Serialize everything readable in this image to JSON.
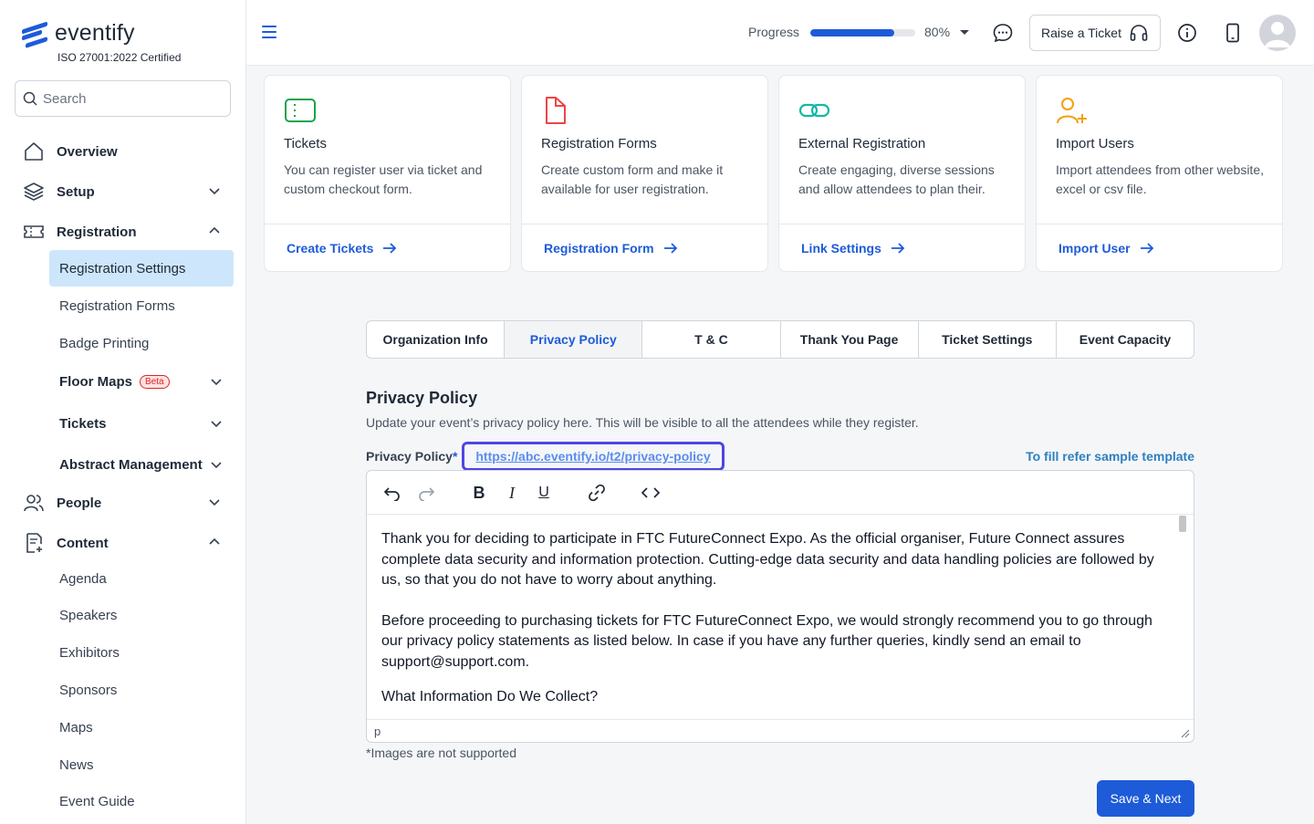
{
  "brand": {
    "name": "eventify",
    "certification": "ISO 27001:2022 Certified",
    "accent": "#1d5bd8"
  },
  "search": {
    "placeholder": "Search"
  },
  "sidebar": {
    "overview": "Overview",
    "setup": "Setup",
    "registration": "Registration",
    "registration_items": [
      "Registration Settings",
      "Registration Forms",
      "Badge Printing"
    ],
    "floor_maps": "Floor Maps",
    "beta": "Beta",
    "tickets": "Tickets",
    "abstract": "Abstract Management",
    "people": "People",
    "content": "Content",
    "content_items": [
      "Agenda",
      "Speakers",
      "Exhibitors",
      "Sponsors",
      "Maps",
      "News",
      "Event Guide"
    ]
  },
  "topbar": {
    "progress_label": "Progress",
    "progress_value": 0.8,
    "progress_pct": "80%",
    "raise_ticket": "Raise a Ticket"
  },
  "cards": [
    {
      "title": "Tickets",
      "desc": "You can register user via ticket and custom checkout form.",
      "link": "Create Tickets",
      "icon": "ticket-icon",
      "color": "#16a34a"
    },
    {
      "title": "Registration Forms",
      "desc": "Create custom form and make it available for user registration.",
      "link": "Registration Form",
      "icon": "document-icon",
      "color": "#ef4444"
    },
    {
      "title": "External Registration",
      "desc": "Create engaging, diverse sessions and allow attendees to plan their.",
      "link": "Link Settings",
      "icon": "link-icon",
      "color": "#14b8a6"
    },
    {
      "title": "Import Users",
      "desc": "Import attendees from other website, excel or csv file.",
      "link": "Import User",
      "icon": "user-plus-icon",
      "color": "#f59e0b"
    }
  ],
  "tabs": [
    "Organization Info",
    "Privacy Policy",
    "T & C",
    "Thank You Page",
    "Ticket Settings",
    "Event Capacity"
  ],
  "active_tab": "Privacy Policy",
  "section": {
    "title": "Privacy Policy",
    "subtitle": "Update your event’s privacy policy here. This will be visible to all the attendees while they register.",
    "field_label": "Privacy Policy",
    "required_mark": "*",
    "link": "https://abc.eventify.io/t2/privacy-policy",
    "refer": "To fill refer sample template"
  },
  "editor": {
    "paragraphs": [
      "Thank you for deciding to participate in FTC FutureConnect Expo. As the official organiser, Future Connect assures complete data security and information protection. Cutting-edge data security and data handling policies are followed by us, so that you do not have to worry about anything.",
      "Before proceeding to purchasing tickets for FTC FutureConnect Expo, we would strongly recommend you to go through our privacy policy statements as listed below. In case if you have any further queries, kindly send an email to support@support.com.",
      "What Information Do We Collect?"
    ],
    "status": "p"
  },
  "note": "*Images are not supported",
  "save_next": "Save & Next"
}
